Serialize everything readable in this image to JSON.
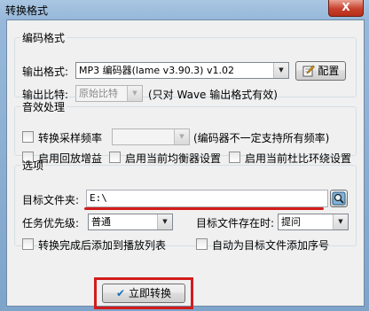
{
  "window": {
    "title": "转换格式",
    "close_glyph": "X"
  },
  "encoding": {
    "legend": "编码格式",
    "output_format_label": "输出格式:",
    "output_format_value": "MP3 编码器(lame v3.90.3) v1.02",
    "config_label": "配置",
    "bitrate_label": "输出比特:",
    "bitrate_value": "原始比特",
    "bitrate_note": "(只对 Wave 输出格式有效)"
  },
  "effects": {
    "legend": "音效处理",
    "resample_label": "转换采样频率",
    "resample_note": "(编码器不一定支持所有频率)",
    "replay_gain_label": "启用回放增益",
    "equalizer_label": "启用当前均衡器设置",
    "dolby_label": "启用当前杜比环绕设置"
  },
  "options": {
    "legend": "选项",
    "target_folder_label": "目标文件夹:",
    "target_folder_value": "E:\\",
    "priority_label": "任务优先级:",
    "priority_value": "普通",
    "exists_label": "目标文件存在时:",
    "exists_value": "提问",
    "add_playlist_label": "转换完成后添加到播放列表",
    "auto_number_label": "自动为目标文件添加序号"
  },
  "actions": {
    "convert_label": "立即转换"
  },
  "colors": {
    "annotation": "#d21c1c",
    "title_bar": "#97b8da"
  }
}
